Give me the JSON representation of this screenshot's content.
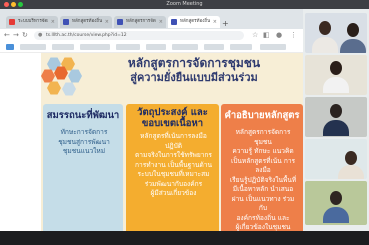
{
  "window": {
    "title": "Zoom Meeting",
    "status_right": ""
  },
  "colors": {
    "tab_bar": "#dfe4e8",
    "slide_bg": "#f7eed6",
    "card1": "#c5dde8",
    "card2": "#f4ad2f",
    "card3": "#ee7f49",
    "title_text": "#2e3a6f"
  },
  "browser": {
    "tabs": [
      {
        "label": "ระบบบริหารจัดการ",
        "icon": "page-icon"
      },
      {
        "label": "หลักสูตรท้องถิ่น",
        "icon": "page-icon"
      },
      {
        "label": "หลักสูตรการจัดการชุมชน",
        "icon": "page-icon"
      },
      {
        "label": "หลักสูตรท้องถิ่น",
        "icon": "page-icon"
      }
    ],
    "new_tab": "+",
    "url": "ts.lllth.ac.th/course/view.php?id=12",
    "nav": {
      "back": "←",
      "forward": "→",
      "reload": "↻"
    }
  },
  "slide": {
    "title": "หลักสูตรการจัดการชุมชน",
    "subtitle": "สู่ความยั่งยืนแบบมีส่วนร่วม",
    "cards": [
      {
        "heading": "สมรรถนะที่พัฒนา",
        "body": "ทักษะการจัดการ\nชุมชนสู่การพัฒนา\nชุมชนแนวใหม่"
      },
      {
        "heading": "วัตถุประสงค์ และ\nขอบเขตเนื้อหา",
        "body": "หลักสูตรที่เน้นการลงมือปฏิบัติ\nตามจริงในการใช้ทรัพยากร\nการทำงาน เป็นพื้นฐานด้าน\nระบบในชุมชนที่เหมาะสม\nร่วมพัฒนากับองค์กร\nผู้มีส่วนเกี่ยวข้อง"
      },
      {
        "heading": "คำอธิบายหลักสูตร",
        "body": "หลักสูตรการจัดการชุมชน\nความรู้ ทักษะ แนวคิด\nเป็นหลักสูตรที่เน้น การลงมือ\nเรียนรู้ปฏิบัติจริงในพื้นที่\nมีเนื้อหาหลัก นำเสนอ\nผ่าน เป็นแนวทาง ร่วมกับ\nองค์กรท้องถิ่น และ\nผู้เกี่ยวข้องในชุมชน"
      }
    ]
  },
  "participants": [
    {
      "name": ""
    },
    {
      "name": ""
    },
    {
      "name": ""
    },
    {
      "name": ""
    },
    {
      "name": ""
    }
  ]
}
